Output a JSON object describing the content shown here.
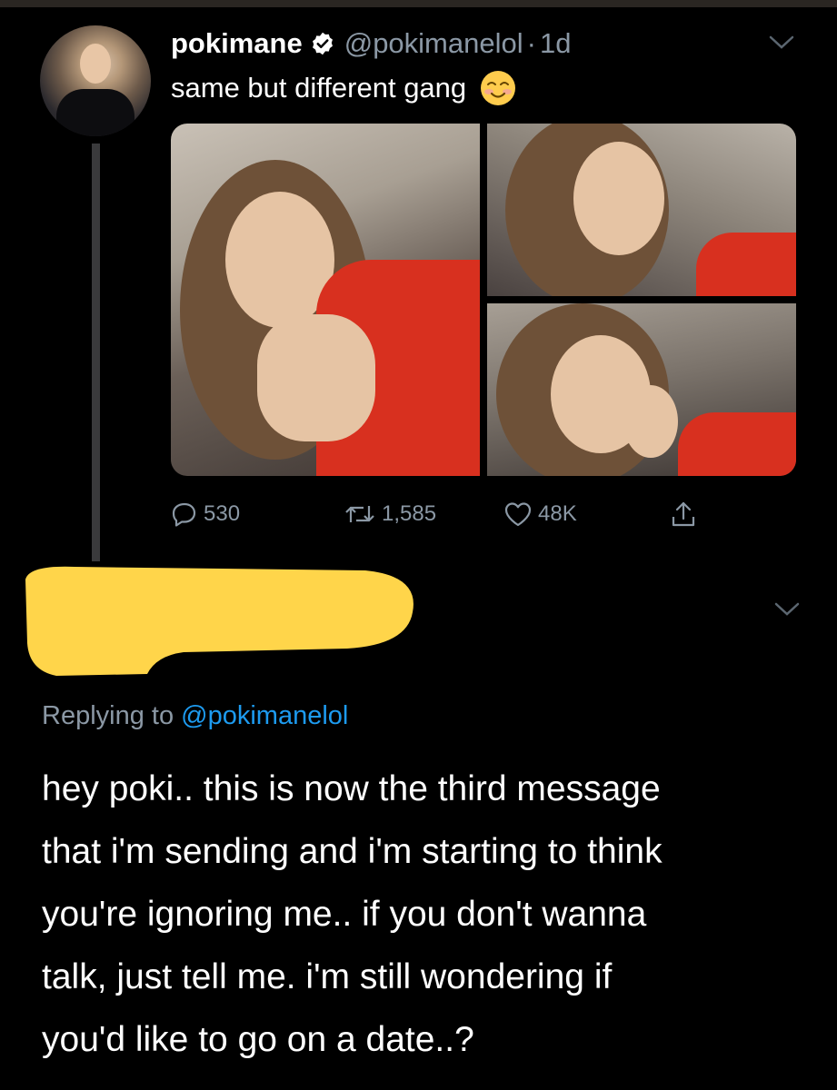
{
  "colors": {
    "background": "#000000",
    "text_primary": "#ffffff",
    "text_secondary": "#8b98a5",
    "accent": "#1d9bf0",
    "verified_badge": "#ffffff",
    "redaction": "#ffd54a"
  },
  "tweet": {
    "author_name": "pokimane",
    "handle": "@pokimanelol",
    "separator": "·",
    "time": "1d",
    "text": "same but different gang",
    "emoji_icon": "smiling-face-emoji",
    "media_count": 3,
    "actions": {
      "replies": "530",
      "retweets": "1,585",
      "likes": "48K"
    }
  },
  "reply": {
    "replying_prefix": "Replying to",
    "replying_mention": "@pokimanelol",
    "text": "hey poki.. this is now the third message\nthat i'm sending and i'm starting to think\nyou're ignoring me.. if you don't wanna\ntalk, just tell me. i'm still wondering if\nyou'd like to go on a date..?"
  }
}
